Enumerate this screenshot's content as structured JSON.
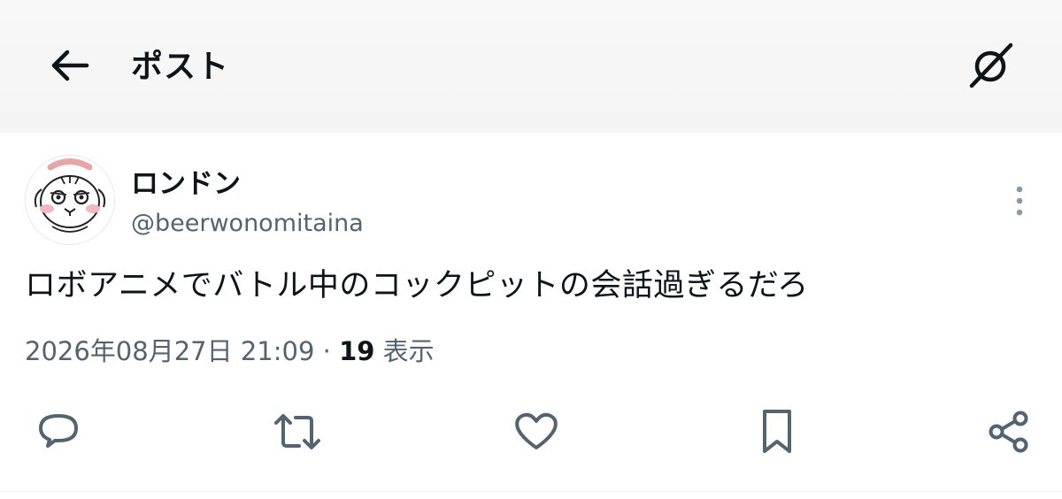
{
  "header": {
    "title": "ポスト",
    "back_icon": "arrow-left-icon",
    "grok_icon": "grok-icon"
  },
  "post": {
    "author": {
      "display_name": "ロンドン",
      "handle": "@beerwonomitaina"
    },
    "text": "ロボアニメでバトル中のコックピットの会話過ぎるだろ",
    "timestamp": "2026年08月27日 21:09",
    "separator": "·",
    "views_count": "19",
    "views_label": "表示"
  },
  "actions": {
    "icons": [
      "reply-icon",
      "repost-icon",
      "like-icon",
      "bookmark-icon",
      "share-icon"
    ]
  },
  "colors": {
    "text": "#0f1419",
    "secondary": "#536471",
    "icon": "#536471",
    "header_bg": "#f6f6f6"
  }
}
